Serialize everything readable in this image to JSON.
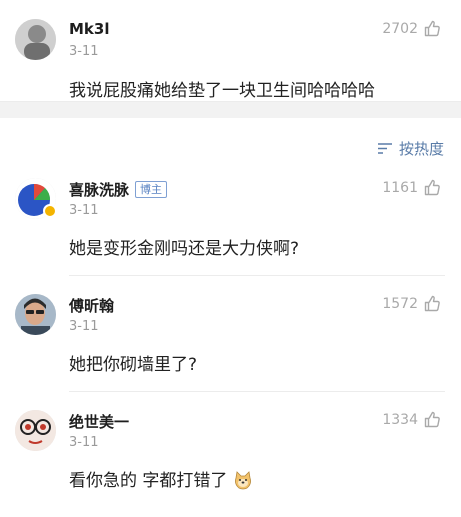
{
  "top_comment": {
    "username": "Mk3l",
    "date": "3-11",
    "likes": "2702",
    "text": "我说屁股痛她给垫了一块卫生间哈哈哈哈"
  },
  "sort": {
    "label": "按热度",
    "icon": "sort-lines-icon"
  },
  "comments": [
    {
      "username": "喜脉洗脉",
      "badge": "博主",
      "date": "3-11",
      "likes": "1161",
      "text": "她是变形金刚吗还是大力侠啊?"
    },
    {
      "username": "傅昕翰",
      "date": "3-11",
      "likes": "1572",
      "text": "她把你砌墙里了?"
    },
    {
      "username": "绝世美一",
      "date": "3-11",
      "likes": "1334",
      "text": "看你急的 字都打错了",
      "emoji": "doge-emoji-icon"
    }
  ],
  "colors": {
    "link": "#5a7ca8",
    "meta": "#9a9a9a",
    "badge": "#5b84c3"
  }
}
